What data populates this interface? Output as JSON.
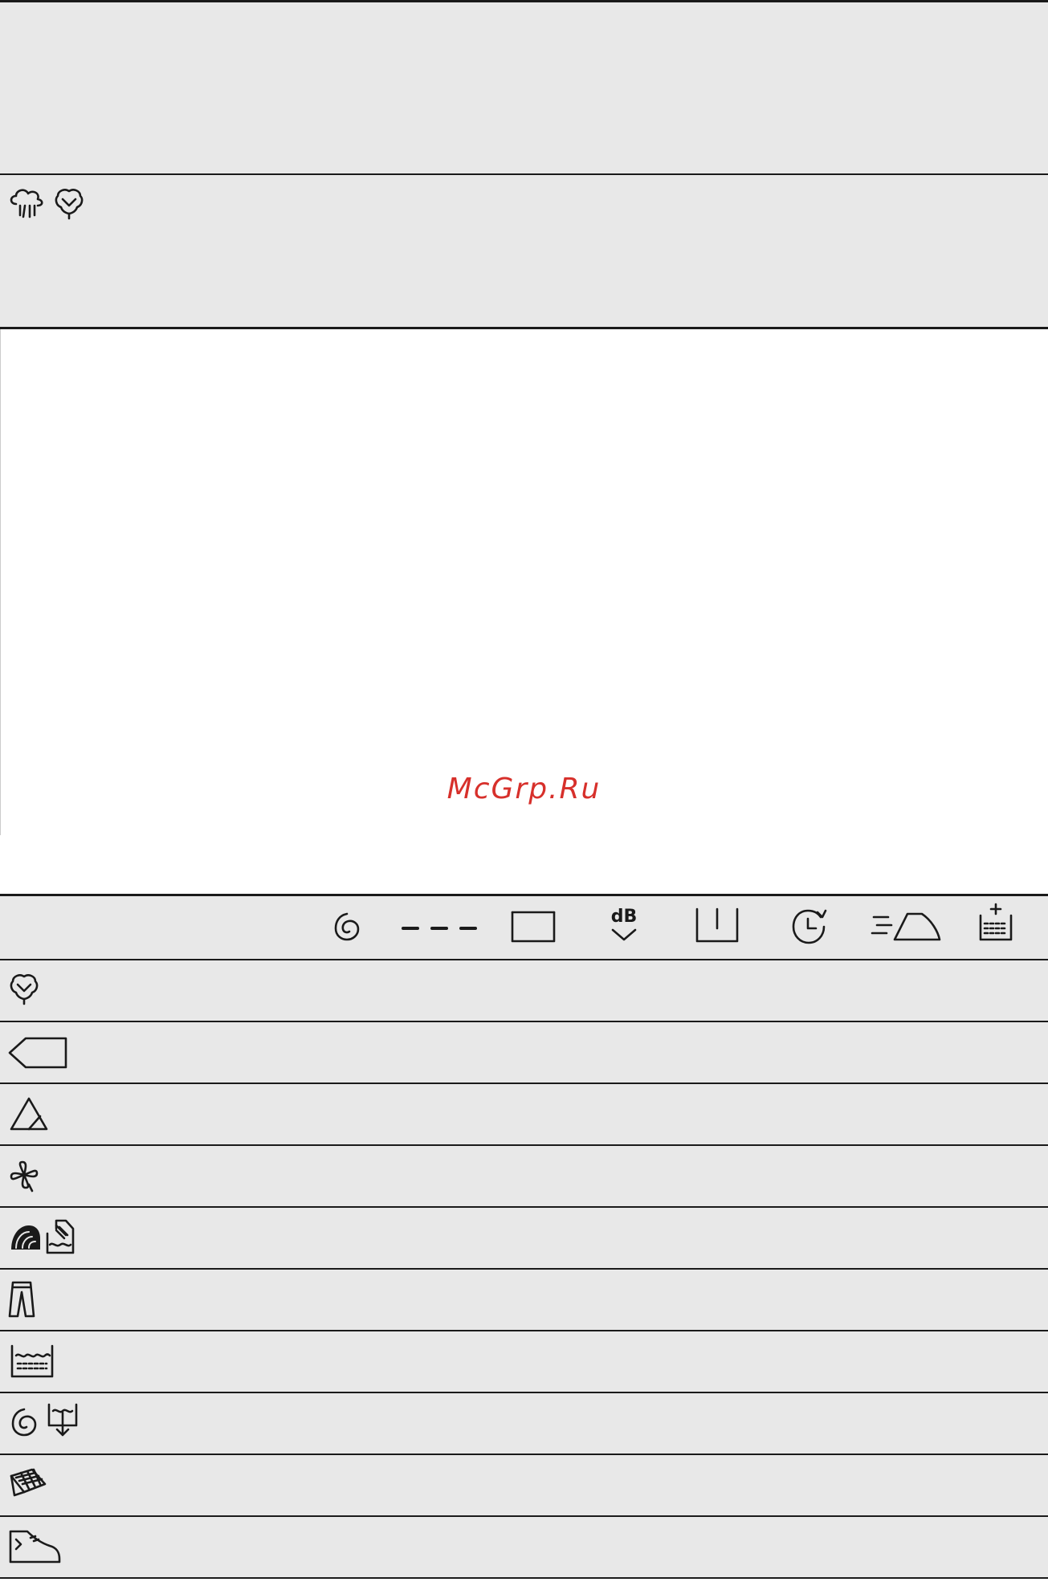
{
  "watermark": "McGrp.Ru",
  "colors": {
    "band": "#e8e8e8",
    "rule": "#1a1a1a",
    "watermark": "#d7302b"
  },
  "top_section": {
    "rows": [
      {
        "icons": []
      },
      {
        "icons": [
          "steam-refresh-icon",
          "cotton-flower-icon"
        ]
      }
    ]
  },
  "option_table": {
    "header_icons": [
      "spin-icon",
      "rinse-dashes-icon",
      "extra-rinse-tub-icon",
      "night-silent-db-icon",
      "rinse-hold-icon",
      "time-save-icon",
      "easy-iron-icon",
      "prewash-icon"
    ],
    "rows": [
      {
        "icons": [
          "cotton-flower-icon"
        ]
      },
      {
        "icons": [
          "synthetics-label-icon"
        ]
      },
      {
        "icons": [
          "delicates-triangle-icon"
        ]
      },
      {
        "icons": [
          "mixed-flower-icon"
        ]
      },
      {
        "icons": [
          "wool-ball-icon",
          "hand-wash-icon"
        ]
      },
      {
        "icons": [
          "denim-jeans-icon"
        ]
      },
      {
        "icons": [
          "rinse-tub-icon"
        ]
      },
      {
        "icons": [
          "spin-icon",
          "drain-icon"
        ]
      },
      {
        "icons": [
          "duvet-icon"
        ]
      },
      {
        "icons": [
          "sport-shoe-icon"
        ]
      }
    ]
  }
}
